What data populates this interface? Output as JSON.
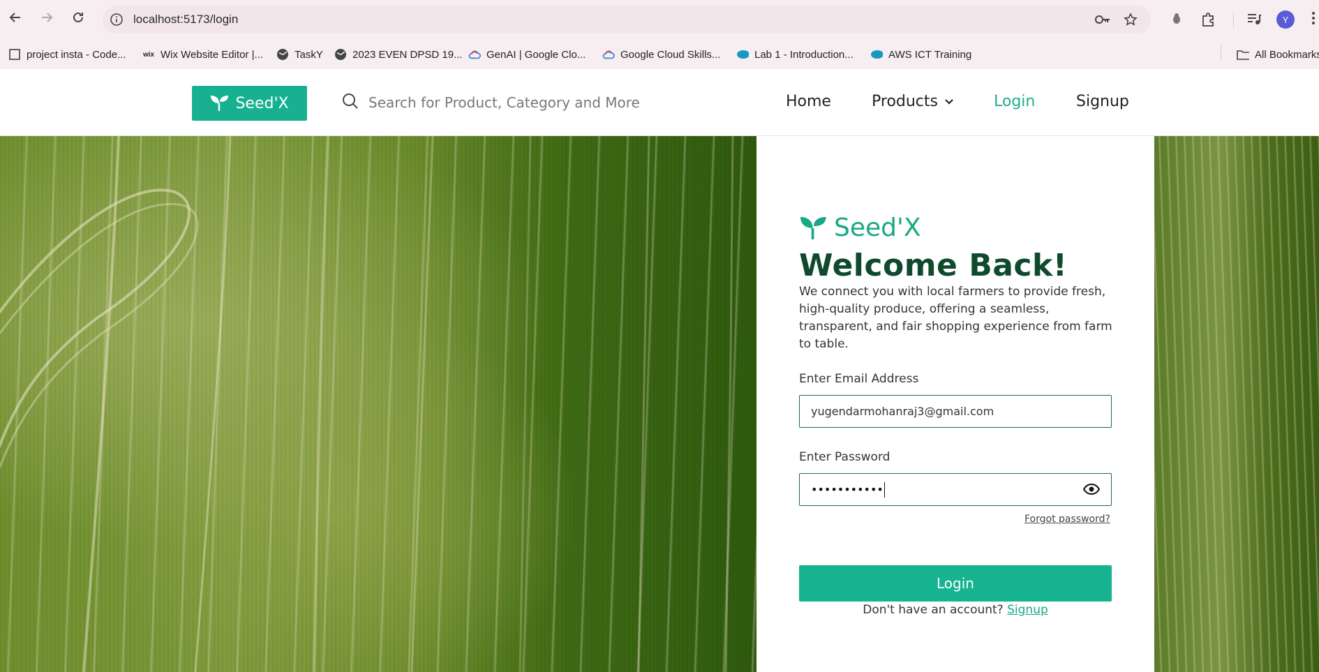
{
  "browser": {
    "url": "localhost:5173/login",
    "profile_initial": "Y",
    "bookmarks": [
      {
        "label": "project insta - Code...",
        "icon": "page-icon"
      },
      {
        "label": "Wix Website Editor |...",
        "icon": "wix-icon"
      },
      {
        "label": "TaskY",
        "icon": "globe-icon"
      },
      {
        "label": "2023 EVEN DPSD 19...",
        "icon": "globe-icon"
      },
      {
        "label": "GenAI | Google Clo...",
        "icon": "google-cloud-icon"
      },
      {
        "label": "Google Cloud Skills...",
        "icon": "google-cloud-icon"
      },
      {
        "label": "Lab 1 - Introduction...",
        "icon": "salesforce-icon"
      },
      {
        "label": "AWS ICT Training",
        "icon": "salesforce-icon"
      }
    ],
    "all_bookmarks": "All Bookmarks"
  },
  "header": {
    "logo_text": "Seed'X",
    "search_placeholder": "Search for Product, Category and More",
    "nav": {
      "home": "Home",
      "products": "Products",
      "login": "Login",
      "signup": "Signup"
    }
  },
  "login": {
    "brand": "Seed'X",
    "title": "Welcome Back!",
    "intro": "We connect you with local farmers to provide fresh, high-quality produce, offering a seamless, transparent, and fair shopping experience from farm to table.",
    "email_label": "Enter Email Address",
    "email_value": "yugendarmohanraj3@gmail.com",
    "password_label": "Enter Password",
    "password_mask": "•••••••••••",
    "forgot": "Forgot password?",
    "login_button": "Login",
    "no_account": "Don't have an account?",
    "signup_link": "Signup"
  },
  "colors": {
    "brand_green": "#17b191",
    "title_green": "#0e4a2c",
    "active_nav": "#1fae8b"
  }
}
